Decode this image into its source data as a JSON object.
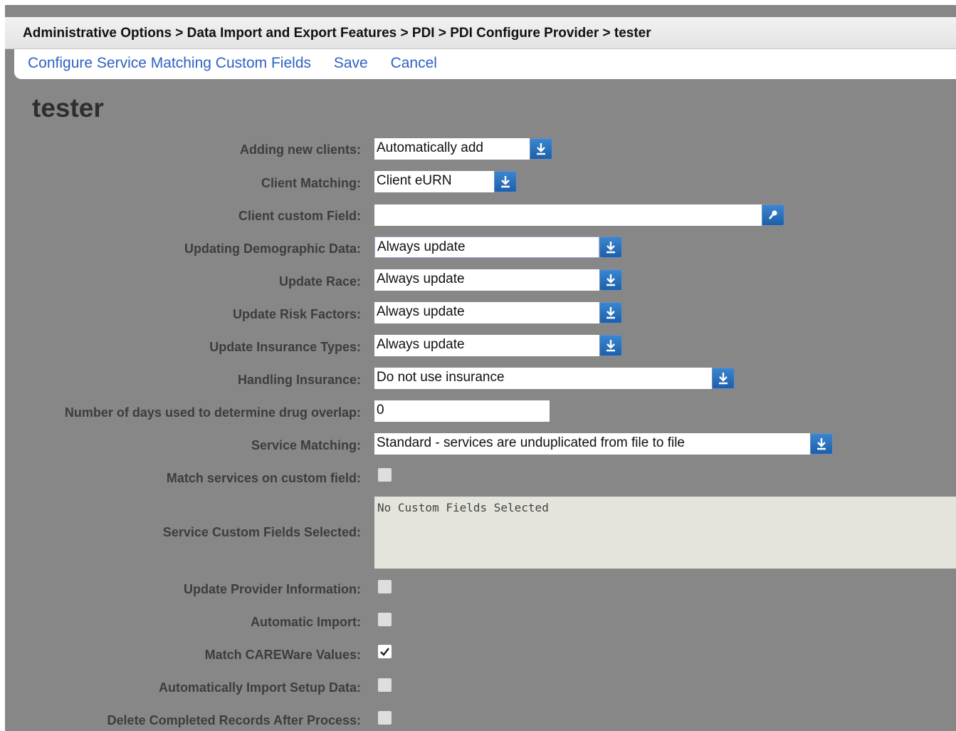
{
  "breadcrumb": "Administrative Options > Data Import and Export Features > PDI > PDI Configure Provider > tester",
  "actions": {
    "configure": "Configure Service Matching Custom Fields",
    "save": "Save",
    "cancel": "Cancel"
  },
  "page_title": "tester",
  "form": {
    "adding_new_clients": {
      "label": "Adding new clients:",
      "value": "Automatically add",
      "icon": "dropdown-arrow-icon"
    },
    "client_matching": {
      "label": "Client Matching:",
      "value": "Client eURN",
      "icon": "dropdown-arrow-icon"
    },
    "client_custom_field": {
      "label": "Client custom Field:",
      "value": "",
      "icon": "lookup-icon"
    },
    "updating_demographic": {
      "label": "Updating Demographic Data:",
      "value": "Always update"
    },
    "update_race": {
      "label": "Update Race:",
      "value": "Always update"
    },
    "update_risk": {
      "label": "Update Risk Factors:",
      "value": "Always update"
    },
    "update_insurance_types": {
      "label": "Update Insurance Types:",
      "value": "Always update"
    },
    "handling_insurance": {
      "label": "Handling Insurance:",
      "value": "Do not use insurance"
    },
    "drug_overlap_days": {
      "label": "Number of days used to determine drug overlap:",
      "value": "0"
    },
    "service_matching": {
      "label": "Service Matching:",
      "value": "Standard - services are unduplicated from file to file"
    },
    "match_services_custom": {
      "label": "Match services on custom field:",
      "checked": false
    },
    "service_custom_fields": {
      "label": "Service Custom Fields Selected:",
      "value": "No Custom Fields Selected"
    },
    "update_provider_info": {
      "label": "Update Provider Information:",
      "checked": false
    },
    "automatic_import": {
      "label": "Automatic Import:",
      "checked": false
    },
    "match_careware_values": {
      "label": "Match CAREWare Values:",
      "checked": true
    },
    "auto_import_setup": {
      "label": "Automatically Import Setup Data:",
      "checked": false
    },
    "delete_completed": {
      "label": "Delete Completed Records After Process:",
      "checked": false
    }
  },
  "colors": {
    "background": "#878787",
    "link": "#2f62c4",
    "button": "#1e5fa8"
  }
}
